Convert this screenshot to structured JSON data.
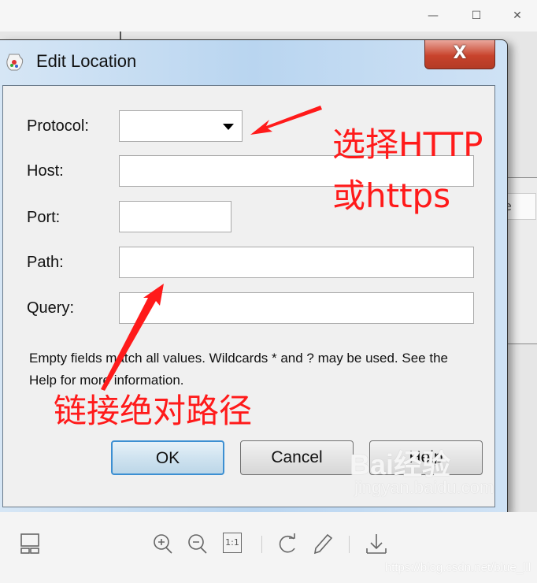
{
  "viewer": {
    "window_controls": {
      "minimize": "—",
      "maximize": "☐",
      "close": "✕"
    },
    "background_button_fragment": "e",
    "toolbar": [
      {
        "name": "thumbnail-icon"
      },
      {
        "name": "zoom-in-icon"
      },
      {
        "name": "zoom-out-icon"
      },
      {
        "name": "actual-size-icon",
        "label": "1:1"
      },
      {
        "name": "rotate-icon"
      },
      {
        "name": "edit-pencil-icon"
      },
      {
        "name": "download-icon"
      }
    ],
    "watermark_url": "https://blog.csdn.net/blue_lll"
  },
  "dialog": {
    "title": "Edit Location",
    "close_label": "X",
    "fields": {
      "protocol": {
        "label": "Protocol:",
        "value": ""
      },
      "host": {
        "label": "Host:",
        "value": ""
      },
      "port": {
        "label": "Port:",
        "value": ""
      },
      "path": {
        "label": "Path:",
        "value": ""
      },
      "query": {
        "label": "Query:",
        "value": ""
      }
    },
    "hint": "Empty fields match all values. Wildcards * and ? may be used. See the Help for more information.",
    "buttons": {
      "ok": "OK",
      "cancel": "Cancel",
      "help": "Help"
    }
  },
  "watermark": {
    "brand": "Bai经验",
    "site": "jingyan.baidu.com"
  },
  "annotations": {
    "protocol_note_line1": "选择HTTP",
    "protocol_note_line2": "或https",
    "path_note": "链接绝对路径",
    "color": "#ff1a1a"
  }
}
